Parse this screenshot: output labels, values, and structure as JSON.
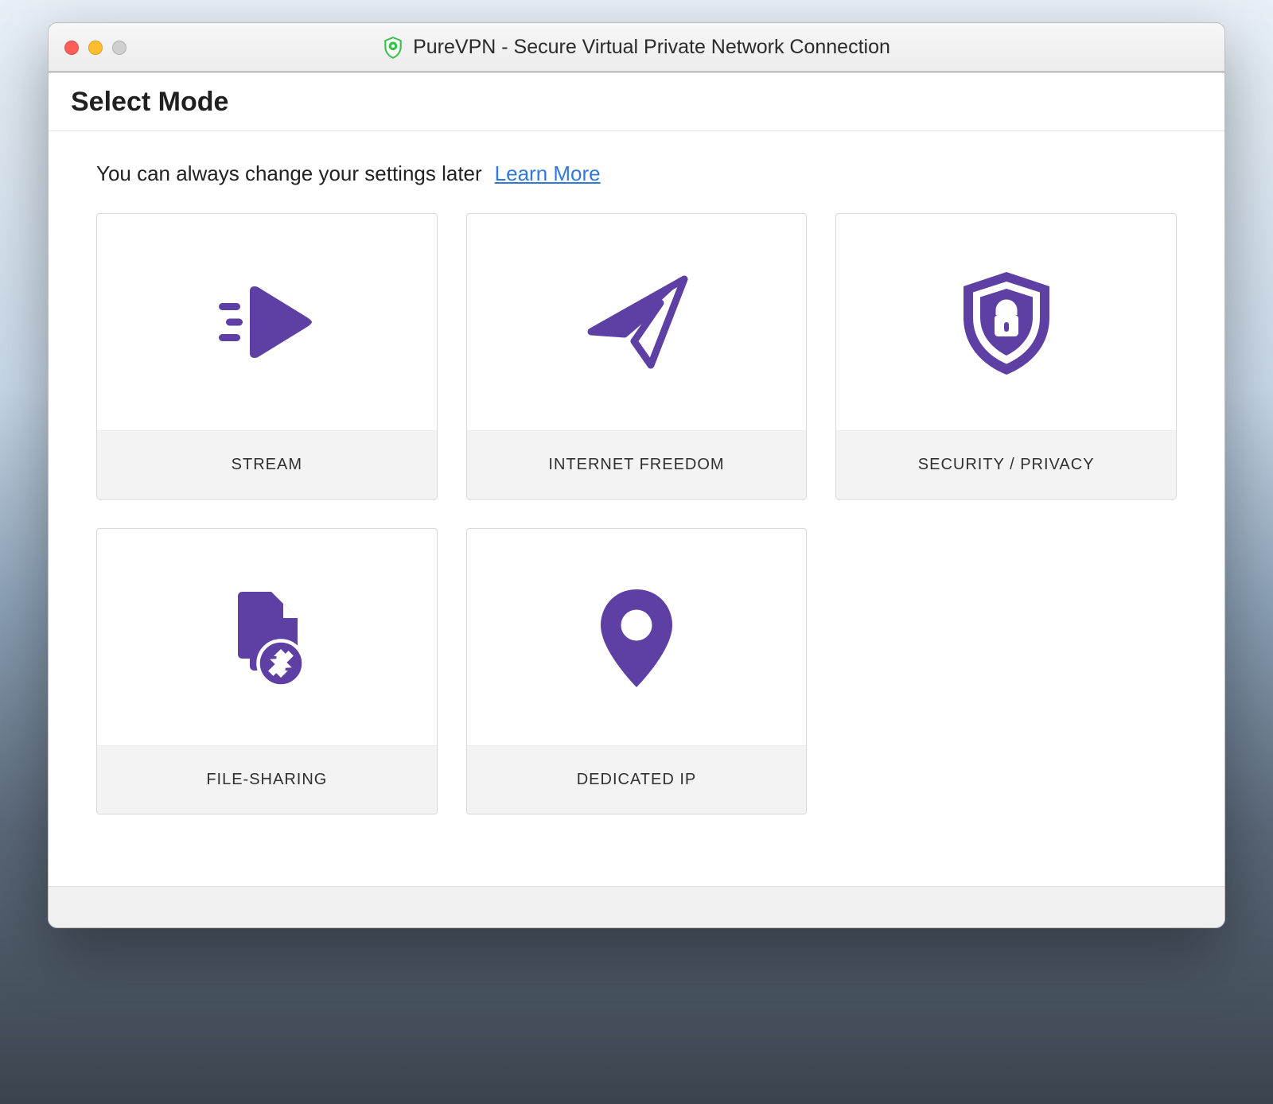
{
  "window": {
    "title": "PureVPN - Secure Virtual Private Network Connection"
  },
  "page": {
    "heading": "Select Mode",
    "hint": "You can always change your settings later",
    "learn_more": "Learn More"
  },
  "modes": [
    {
      "id": "stream",
      "label": "STREAM",
      "icon": "stream-icon"
    },
    {
      "id": "internet-freedom",
      "label": "INTERNET FREEDOM",
      "icon": "paper-plane-icon"
    },
    {
      "id": "security-privacy",
      "label": "SECURITY / PRIVACY",
      "icon": "shield-lock-icon"
    },
    {
      "id": "file-sharing",
      "label": "FILE-SHARING",
      "icon": "file-sync-icon"
    },
    {
      "id": "dedicated-ip",
      "label": "DEDICATED IP",
      "icon": "map-pin-icon"
    }
  ],
  "colors": {
    "accent": "#5e3fa3",
    "link": "#2f79e0"
  }
}
